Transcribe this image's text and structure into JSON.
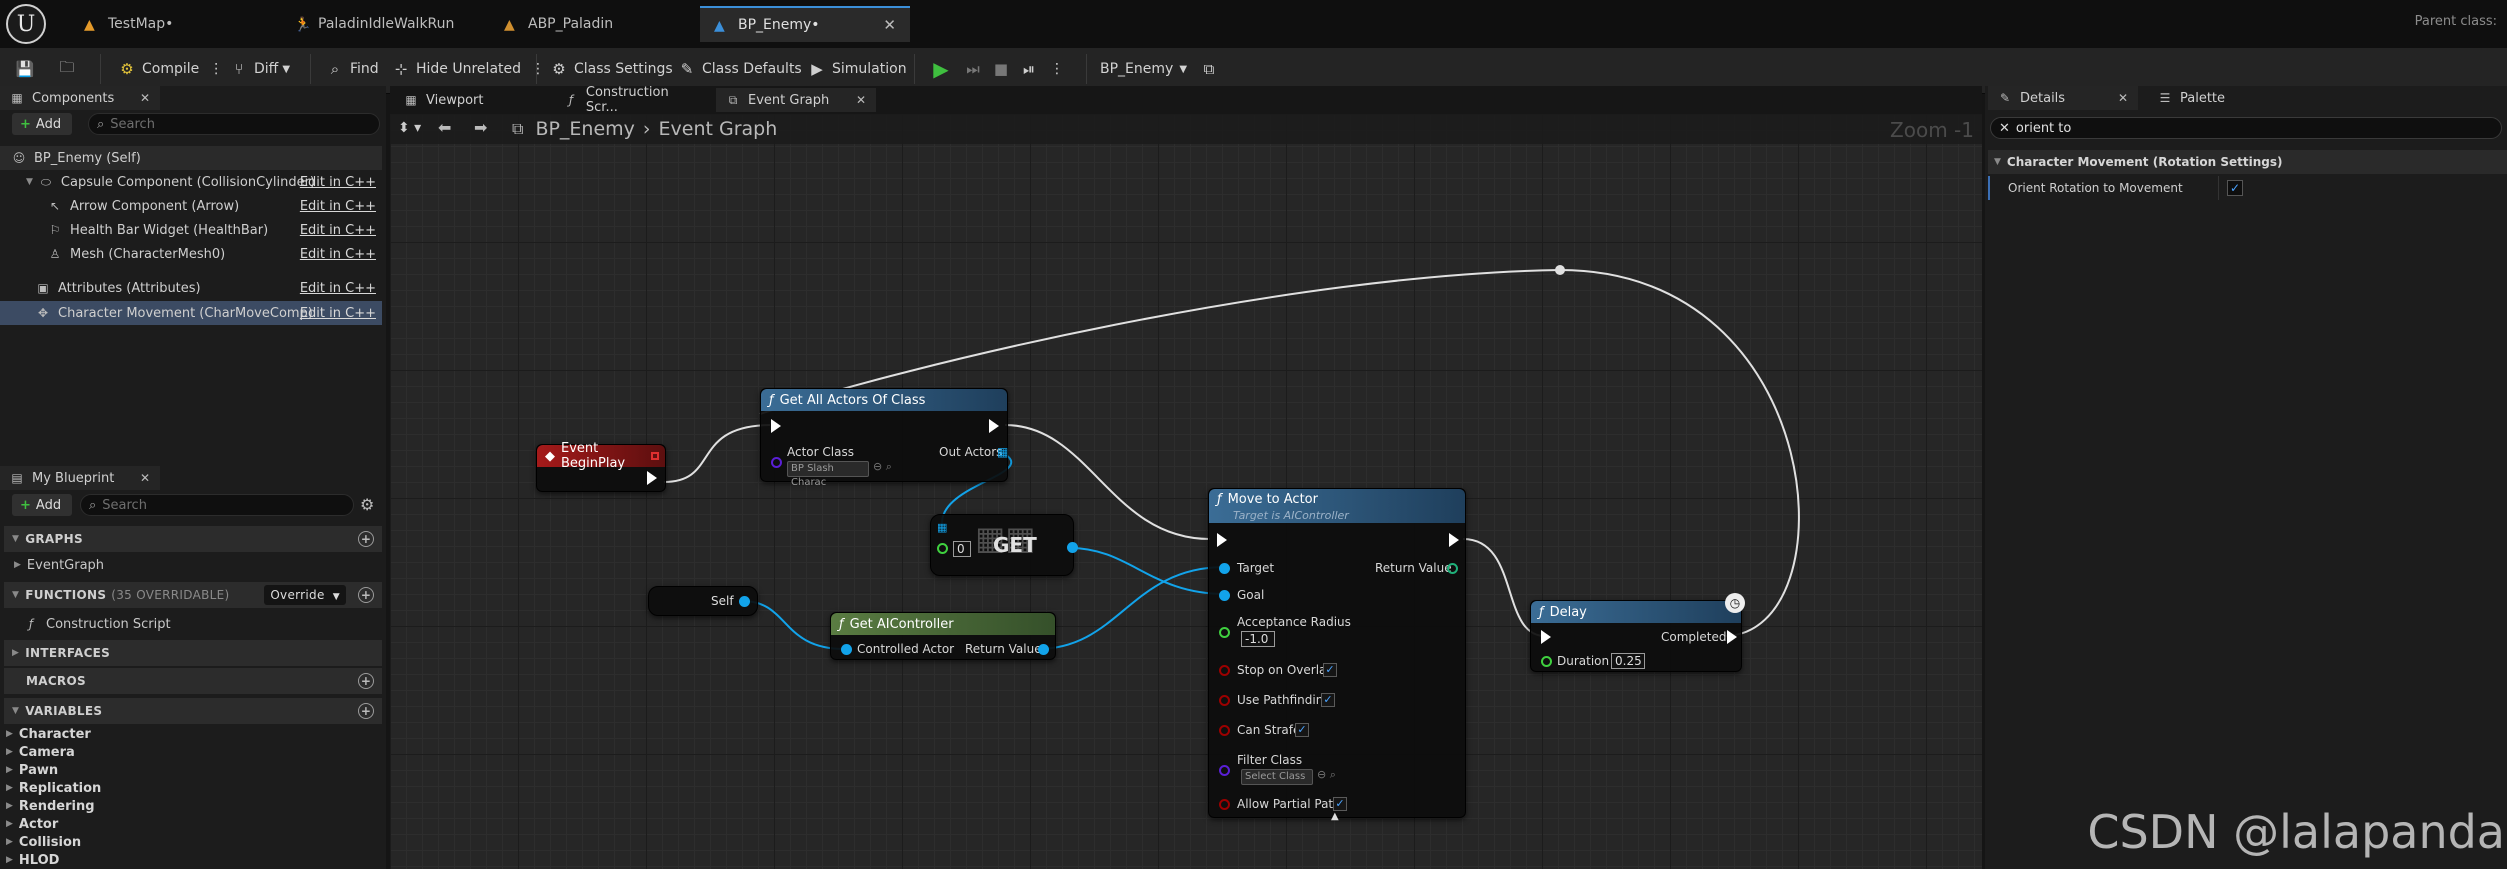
{
  "document_tabs": [
    {
      "label": "TestMap•",
      "icon": "level-icon",
      "active": false
    },
    {
      "label": "PaladinIdleWalkRun",
      "icon": "animation-icon",
      "active": false
    },
    {
      "label": "ABP_Paladin",
      "icon": "anim-blueprint-icon",
      "active": false
    },
    {
      "label": "BP_Enemy•",
      "icon": "blueprint-icon",
      "active": true
    }
  ],
  "parent_class": "Parent class: ",
  "toolbar": {
    "compile": "Compile",
    "diff": "Diff",
    "find": "Find",
    "hide_unrelated": "Hide Unrelated",
    "class_settings": "Class Settings",
    "class_defaults": "Class Defaults",
    "simulation": "Simulation",
    "debug_object": "BP_Enemy"
  },
  "components_panel": {
    "title": "Components",
    "add_label": "Add",
    "search_placeholder": "Search",
    "items": [
      {
        "label": "BP_Enemy (Self)",
        "edit": ""
      },
      {
        "label": "Capsule Component (CollisionCylinder)",
        "edit": "Edit in C++"
      },
      {
        "label": "Arrow Component (Arrow)",
        "edit": "Edit in C++"
      },
      {
        "label": "Health Bar Widget (HealthBar)",
        "edit": "Edit in C++"
      },
      {
        "label": "Mesh (CharacterMesh0)",
        "edit": "Edit in C++"
      },
      {
        "label": "Attributes (Attributes)",
        "edit": "Edit in C++"
      },
      {
        "label": "Character Movement (CharMoveComp)",
        "edit": "Edit in C++"
      }
    ]
  },
  "my_blueprint": {
    "title": "My Blueprint",
    "add_label": "Add",
    "search_placeholder": "Search",
    "graphs": "GRAPHS",
    "event_graph": "EventGraph",
    "functions": "FUNCTIONS",
    "functions_sub": "(35 OVERRIDABLE)",
    "override": "Override",
    "construction_script": "Construction Script",
    "interfaces": "INTERFACES",
    "macros": "MACROS",
    "variables": "VARIABLES",
    "categories": [
      "Character",
      "Camera",
      "Pawn",
      "Replication",
      "Rendering",
      "Actor",
      "Collision",
      "HLOD"
    ]
  },
  "graph_tabs": [
    {
      "label": "Viewport"
    },
    {
      "label": "Construction Scr..."
    },
    {
      "label": "Event Graph"
    }
  ],
  "breadcrumb": {
    "root": "BP_Enemy",
    "current": "Event Graph"
  },
  "zoom": "Zoom -1",
  "nodes": {
    "begin_play": {
      "title": "Event BeginPlay"
    },
    "get_all_actors": {
      "title": "Get All Actors Of Class",
      "actor_class_label": "Actor Class",
      "actor_class_value": "BP Slash Charac",
      "out_actors": "Out Actors"
    },
    "get": {
      "title": "GET",
      "index": "0"
    },
    "self": {
      "title": "Self"
    },
    "get_ai_controller": {
      "title": "Get AIController",
      "controlled_actor": "Controlled Actor",
      "return_value": "Return Value"
    },
    "move_to_actor": {
      "title": "Move to Actor",
      "subtitle": "Target is AIController",
      "target": "Target",
      "return_value": "Return Value",
      "goal": "Goal",
      "acceptance_radius": "Acceptance Radius",
      "acceptance_value": "-1.0",
      "stop_on_overlap": "Stop on Overlap",
      "use_pathfinding": "Use Pathfinding",
      "can_strafe": "Can Strafe",
      "filter_class": "Filter Class",
      "filter_value": "Select Class",
      "allow_partial_path": "Allow Partial Path"
    },
    "delay": {
      "title": "Delay",
      "completed": "Completed",
      "duration": "Duration",
      "duration_value": "0.25"
    }
  },
  "details_panel": {
    "title": "Details",
    "palette": "Palette",
    "search_value": "orient to",
    "section": "Character Movement (Rotation Settings)",
    "property": "Orient Rotation to Movement",
    "checked": true
  },
  "watermark": "CSDN @lalapanda",
  "colors": {
    "exec_white": "#ffffff",
    "object_blue": "#12a3ea",
    "class_purple": "#5a1fd6",
    "bool_red": "#9c0000",
    "float_green": "#3fd03f",
    "event_red": "#8c1414",
    "function_blue": "#2d5c86",
    "pure_green": "#4d6a37"
  }
}
